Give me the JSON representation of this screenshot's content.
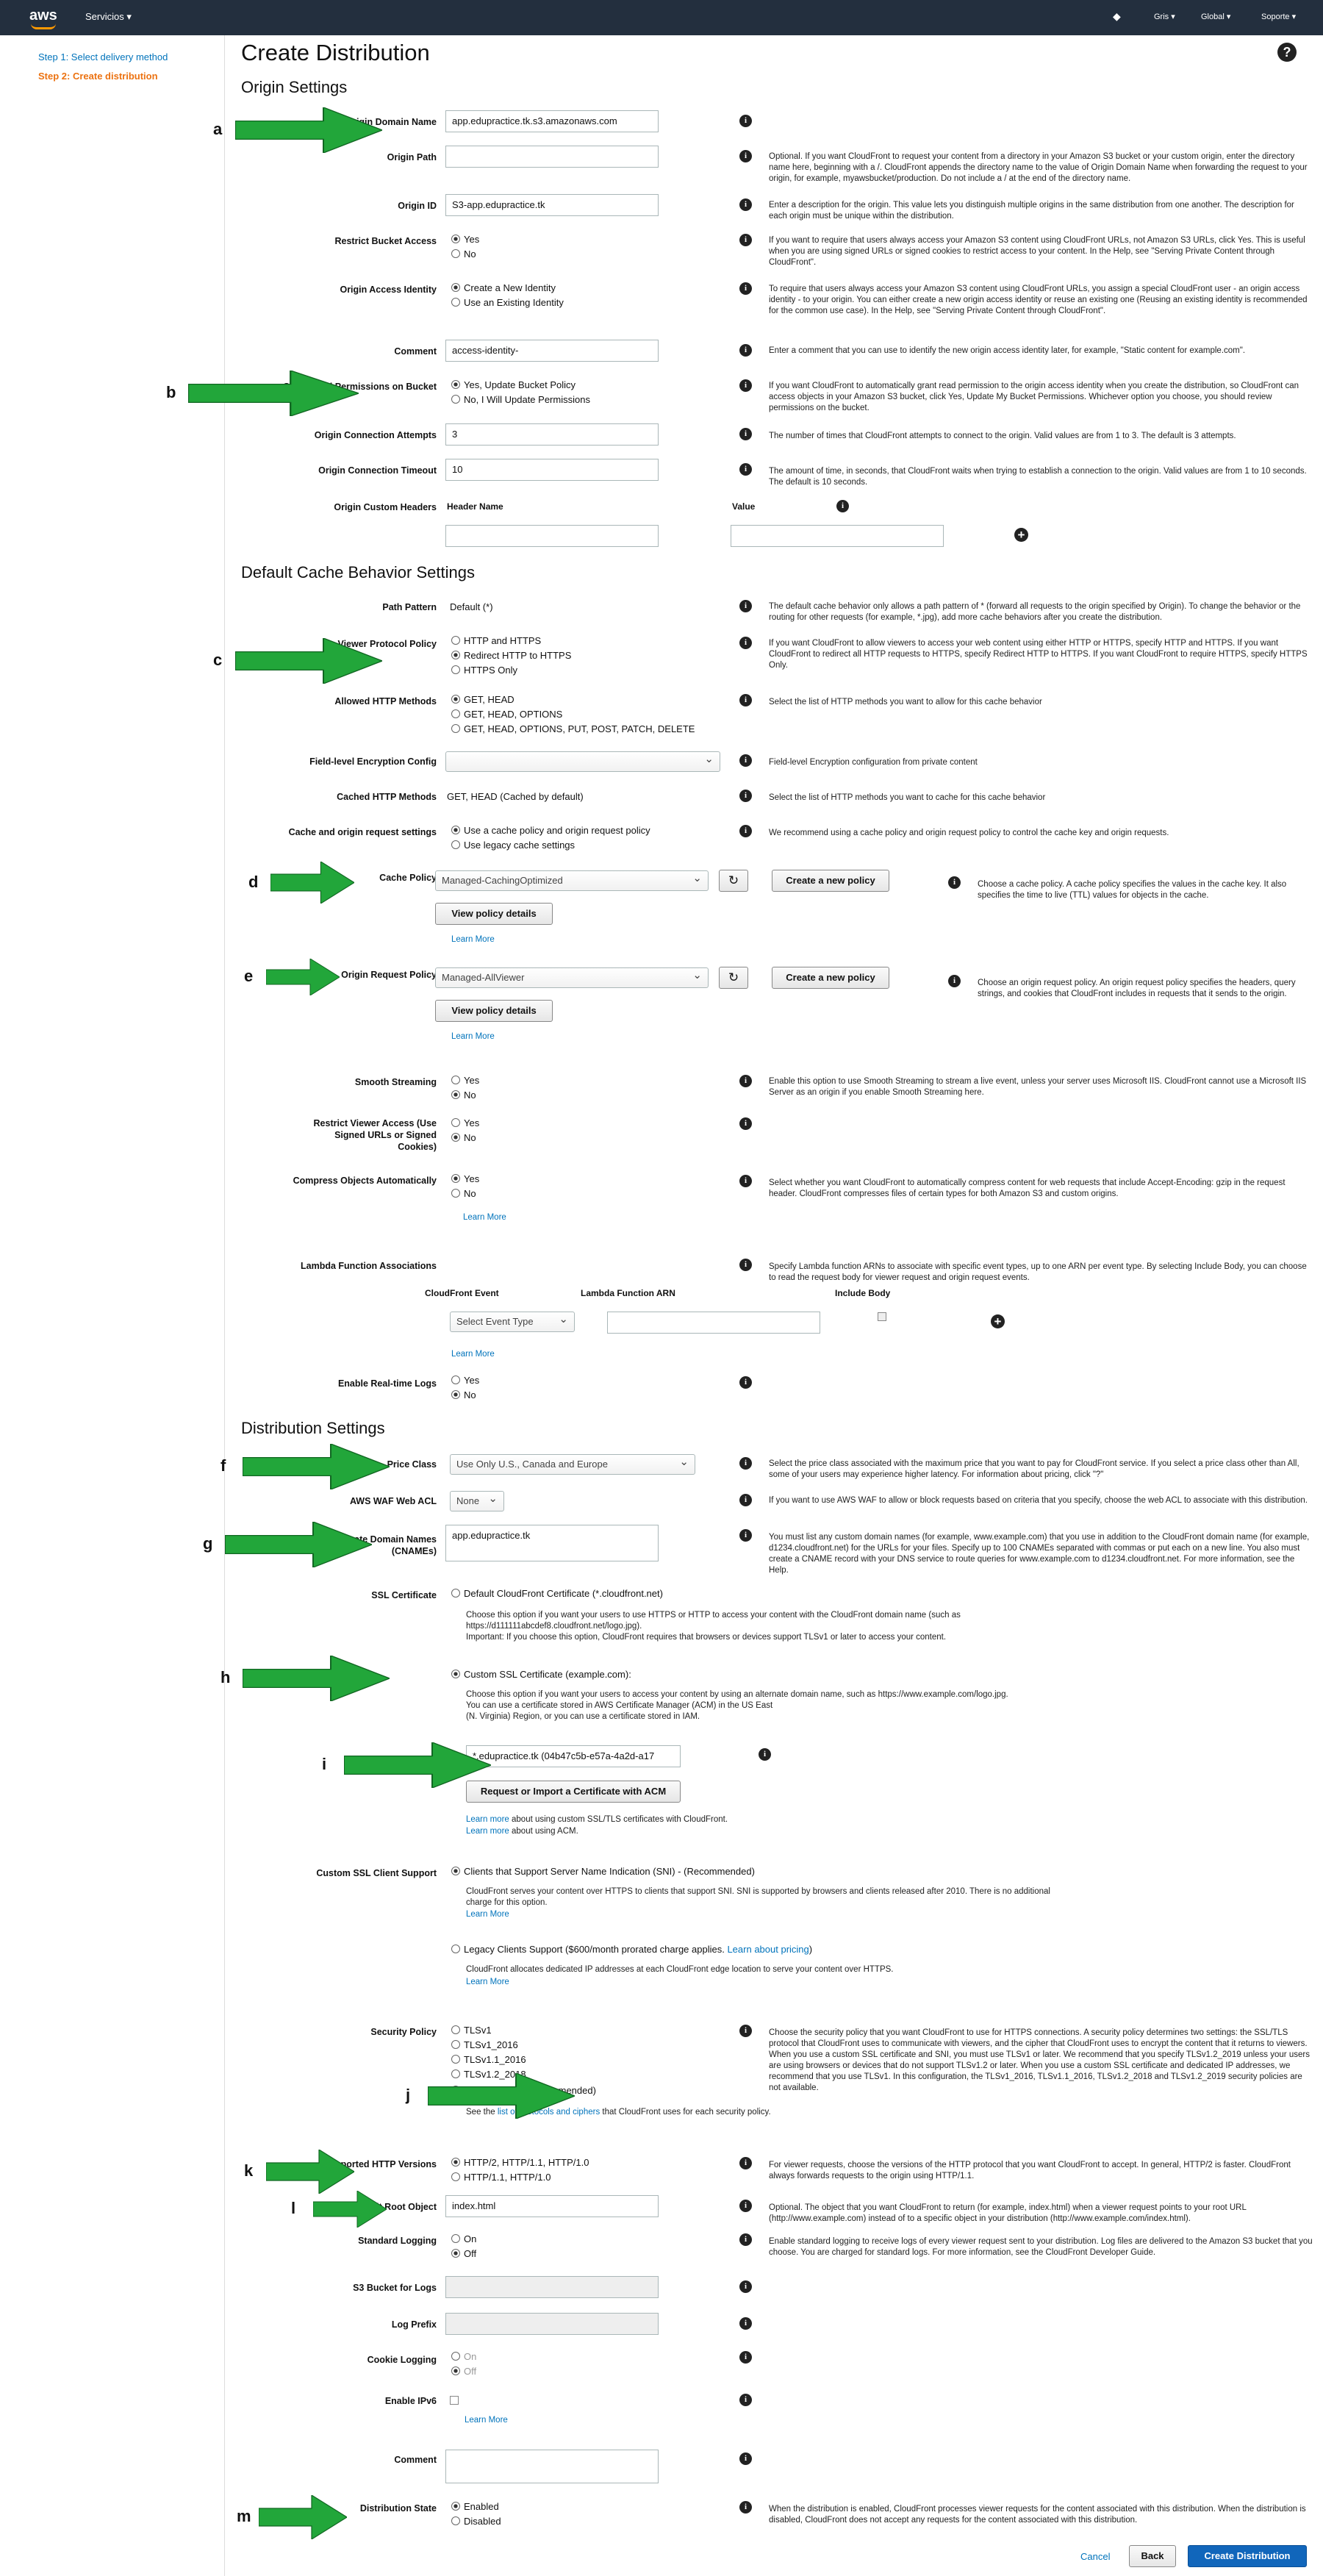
{
  "nav": {
    "logo": "aws",
    "services": "Servicios ▾",
    "user": "Gris ▾",
    "region": "Global ▾",
    "support": "Soporte ▾"
  },
  "side": {
    "step1": "Step 1: Select delivery method",
    "step2": "Step 2: Create distribution"
  },
  "title": "Create Distribution",
  "help_icon": "?",
  "sections": {
    "origin": "Origin Settings",
    "cache": "Default Cache Behavior Settings",
    "dist": "Distribution Settings"
  },
  "letters": [
    "a",
    "b",
    "c",
    "d",
    "e",
    "f",
    "g",
    "h",
    "i",
    "j",
    "k",
    "l",
    "m"
  ],
  "origin": {
    "domain_label": "Origin Domain Name",
    "domain_value": "app.edupractice.tk.s3.amazonaws.com",
    "path_label": "Origin Path",
    "path_desc": "Optional. If you want CloudFront to request your content from a directory in your Amazon S3 bucket or your custom origin, enter the directory name here, beginning with a /. CloudFront appends the directory name to the value of Origin Domain Name when forwarding the request to your origin, for example, myawsbucket/production. Do not include a / at the end of the directory name.",
    "id_label": "Origin ID",
    "id_value": "S3-app.edupractice.tk",
    "id_desc": "Enter a description for the origin. This value lets you distinguish multiple origins in the same distribution from one another. The description for each origin must be unique within the distribution.",
    "restrict_label": "Restrict Bucket Access",
    "yes": "Yes",
    "no": "No",
    "restrict_desc": "If you want to require that users always access your Amazon S3 content using CloudFront URLs, not Amazon S3 URLs, click Yes. This is useful when you are using signed URLs or signed cookies to restrict access to your content. In the Help, see \"Serving Private Content through CloudFront\".",
    "oai_label": "Origin Access Identity",
    "oai_new": "Create a New Identity",
    "oai_existing": "Use an Existing Identity",
    "oai_desc": "To require that users always access your Amazon S3 content using CloudFront URLs, you assign a special CloudFront user - an origin access identity - to your origin. You can either create a new origin access identity or reuse an existing one (Reusing an existing identity is recommended for the common use case). In the Help, see \"Serving Private Content through CloudFront\".",
    "comment_label": "Comment",
    "comment_value": "access-identity-",
    "comment_desc": "Enter a comment that you can use to identify the new origin access identity later, for example, \"Static content for example.com\".",
    "grant_label": "Grant Read Permissions on Bucket",
    "grant_yes": "Yes, Update Bucket Policy",
    "grant_no": "No, I Will Update Permissions",
    "grant_desc": "If you want CloudFront to automatically grant read permission to the origin access identity when you create the distribution, so CloudFront can access objects in your Amazon S3 bucket, click Yes, Update My Bucket Permissions. Whichever option you choose, you should review permissions on the bucket.",
    "attempts_label": "Origin Connection Attempts",
    "attempts_value": "3",
    "attempts_desc": "The number of times that CloudFront attempts to connect to the origin. Valid values are from 1 to 3. The default is 3 attempts.",
    "timeout_label": "Origin Connection Timeout",
    "timeout_value": "10",
    "timeout_desc": "The amount of time, in seconds, that CloudFront waits when trying to establish a connection to the origin. Valid values are from 1 to 10 seconds. The default is 10 seconds.",
    "headers_label": "Origin Custom Headers",
    "header_name": "Header Name",
    "value": "Value"
  },
  "cache": {
    "pattern_label": "Path Pattern",
    "pattern_value": "Default (*)",
    "pattern_desc": "The default cache behavior only allows a path pattern of * (forward all requests to the origin specified by Origin). To change the behavior or the routing for other requests (for example, *.jpg), add more cache behaviors after you create the distribution.",
    "vpp_label": "Viewer Protocol Policy",
    "vpp": [
      "HTTP and HTTPS",
      "Redirect HTTP to HTTPS",
      "HTTPS Only"
    ],
    "vpp_desc": "If you want CloudFront to allow viewers to access your web content using either HTTP or HTTPS, specify HTTP and HTTPS. If you want CloudFront to redirect all HTTP requests to HTTPS, specify Redirect HTTP to HTTPS. If you want CloudFront to require HTTPS, specify HTTPS Only.",
    "methods_label": "Allowed HTTP Methods",
    "methods": [
      "GET, HEAD",
      "GET, HEAD, OPTIONS",
      "GET, HEAD, OPTIONS, PUT, POST, PATCH, DELETE"
    ],
    "methods_desc": "Select the list of HTTP methods you want to allow for this cache behavior",
    "fle_label": "Field-level Encryption Config",
    "fle_desc": "Field-level Encryption configuration from private content",
    "cached_label": "Cached HTTP Methods",
    "cached_value": "GET, HEAD (Cached by default)",
    "cached_desc": "Select the list of HTTP methods you want to cache for this cache behavior",
    "corp_label": "Cache and origin request settings",
    "corp_policy": "Use a cache policy and origin request policy",
    "corp_legacy": "Use legacy cache settings",
    "corp_desc": "We recommend using a cache policy and origin request policy to control the cache key and origin requests.",
    "cp_label": "Cache Policy",
    "cp_value": "Managed-CachingOptimized",
    "create_policy": "Create a new policy",
    "view_policy": "View policy details",
    "learn_more": "Learn More",
    "cp_desc": "Choose a cache policy. A cache policy specifies the values in the cache key. It also specifies the time to live (TTL) values for objects in the cache.",
    "orp_label": "Origin Request Policy",
    "orp_value": "Managed-AllViewer",
    "orp_desc": "Choose an origin request policy. An origin request policy specifies the headers, query strings, and cookies that CloudFront includes in requests that it sends to the origin.",
    "smooth_label": "Smooth Streaming",
    "smooth_desc": "Enable this option to use Smooth Streaming to stream a live event, unless your server uses Microsoft IIS. CloudFront cannot use a Microsoft IIS Server as an origin if you enable Smooth Streaming here.",
    "restrict_label": "Restrict Viewer Access (Use Signed URLs or Signed Cookies)",
    "compress_label": "Compress Objects Automatically",
    "compress_desc": "Select whether you want CloudFront to automatically compress content for web requests that include Accept-Encoding: gzip in the request header. CloudFront compresses files of certain types for both Amazon S3 and custom origins.",
    "lambda_label": "Lambda Function Associations",
    "lambda_desc": "Specify Lambda function ARNs to associate with specific event types, up to one ARN per event type. By selecting Include Body, you can choose to read the request body for viewer request and origin request events.",
    "cf_event": "CloudFront Event",
    "lambda_arn": "Lambda Function ARN",
    "include_body": "Include Body",
    "select_event": "Select Event Type",
    "rtl_label": "Enable Real-time Logs"
  },
  "dist": {
    "price_label": "Price Class",
    "price_value": "Use Only U.S., Canada and Europe",
    "price_desc": "Select the price class associated with the maximum price that you want to pay for CloudFront service. If you select a price class other than All, some of your users may experience higher latency. For information about pricing, click \"?\"",
    "waf_label": "AWS WAF Web ACL",
    "waf_value": "None",
    "waf_desc": "If you want to use AWS WAF to allow or block requests based on criteria that you specify, choose the web ACL to associate with this distribution.",
    "cname_label": "Alternate Domain Names (CNAMEs)",
    "cname_value": "app.edupractice.tk",
    "cname_desc": "You must list any custom domain names (for example, www.example.com) that you use in addition to the CloudFront domain name (for example, d1234.cloudfront.net) for the URLs for your files. Specify up to 100 CNAMEs separated with commas or put each on a new line. You also must create a CNAME record with your DNS service to route queries for www.example.com to d1234.cloudfront.net. For more information, see the Help.",
    "ssl_label": "SSL Certificate",
    "ssl_default": "Default CloudFront Certificate (*.cloudfront.net)",
    "ssl_default_note": "Choose this option if you want your users to use HTTPS or HTTP to access your content with the CloudFront domain name (such as https://d111111abcdef8.cloudfront.net/logo.jpg).\nImportant: If you choose this option, CloudFront requires that browsers or devices support TLSv1 or later to access your content.",
    "ssl_custom": "Custom SSL Certificate (example.com):",
    "ssl_custom_note": "Choose this option if you want your users to access your content by using an alternate domain name, such as https://www.example.com/logo.jpg.\nYou can use a certificate stored in AWS Certificate Manager (ACM) in the US East\n(N. Virginia) Region, or you can use a certificate stored in IAM.",
    "cert_value": "*.edupractice.tk (04b47c5b-e57a-4a2d-a17",
    "acm_button": "Request or Import a Certificate with ACM",
    "learn_custom": "Learn more",
    "learn_custom_tail": " about using custom SSL/TLS certificates with CloudFront.",
    "learn_acm": "Learn more",
    "learn_acm_tail": " about using ACM.",
    "client_label": "Custom SSL Client Support",
    "sni": "Clients that Support Server Name Indication (SNI) - (Recommended)",
    "sni_note": "CloudFront serves your content over HTTPS to clients that support SNI. SNI is supported by browsers and clients released after 2010. There is no additional charge for this option.",
    "legacy": "Legacy Clients Support ($600/month prorated charge applies. ",
    "legacy_link": "Learn about pricing",
    ")": ")",
    "legacy_note": "CloudFront allocates dedicated IP addresses at each CloudFront edge location to serve your content over HTTPS.",
    "secpol_label": "Security Policy",
    "secpol": [
      "TLSv1",
      "TLSv1_2016",
      "TLSv1.1_2016",
      "TLSv1.2_2018",
      "TLSv1.2_2019 (recommended)"
    ],
    "secpol_see": "See the ",
    "secpol_link": "list of protocols and ciphers",
    "secpol_tail": " that CloudFront uses for each security policy.",
    "secpol_desc": "Choose the security policy that you want CloudFront to use for HTTPS connections. A security policy determines two settings: the SSL/TLS protocol that CloudFront uses to communicate with viewers, and the cipher that CloudFront uses to encrypt the content that it returns to viewers. When you use a custom SSL certificate and SNI, you must use TLSv1 or later. We recommend that you specify TLSv1.2_2019 unless your users are using browsers or devices that do not support TLSv1.2 or later. When you use a custom SSL certificate and dedicated IP addresses, we recommend that you use TLSv1. In this configuration, the TLSv1_2016, TLSv1.1_2016, TLSv1.2_2018 and TLSv1.2_2019 security policies are not available.",
    "http_label": "Supported HTTP Versions",
    "http": [
      "HTTP/2, HTTP/1.1, HTTP/1.0",
      "HTTP/1.1, HTTP/1.0"
    ],
    "http_desc": "For viewer requests, choose the versions of the HTTP protocol that you want CloudFront to accept. In general, HTTP/2 is faster. CloudFront always forwards requests to the origin using HTTP/1.1.",
    "root_label": "Default Root Object",
    "root_value": "index.html",
    "root_desc": "Optional. The object that you want CloudFront to return (for example, index.html) when a viewer request points to your root URL (http://www.example.com) instead of to a specific object in your distribution (http://www.example.com/index.html).",
    "logging_label": "Standard Logging",
    "on": "On",
    "off": "Off",
    "logging_desc": "Enable standard logging to receive logs of every viewer request sent to your distribution. Log files are delivered to the Amazon S3 bucket that you choose. You are charged for standard logs. For more information, see the CloudFront Developer Guide.",
    "bucket_label": "S3 Bucket for Logs",
    "prefix_label": "Log Prefix",
    "cookie_label": "Cookie Logging",
    "ipv6_label": "Enable IPv6",
    "learn_more": "Learn More",
    "comment_label": "Comment",
    "state_label": "Distribution State",
    "enabled": "Enabled",
    "disabled": "Disabled",
    "state_desc": "When the distribution is enabled, CloudFront processes viewer requests for the content associated with this distribution. When the distribution is disabled, CloudFront does not accept any requests for the content associated with this distribution."
  },
  "footer": {
    "cancel": "Cancel",
    "back": "Back",
    "create": "Create Distribution"
  },
  "colors": {
    "nav": "#232f3e",
    "link": "#0073bb",
    "step_active": "#ec7211",
    "arrow": "#22a63a",
    "primary": "#1166bb"
  }
}
